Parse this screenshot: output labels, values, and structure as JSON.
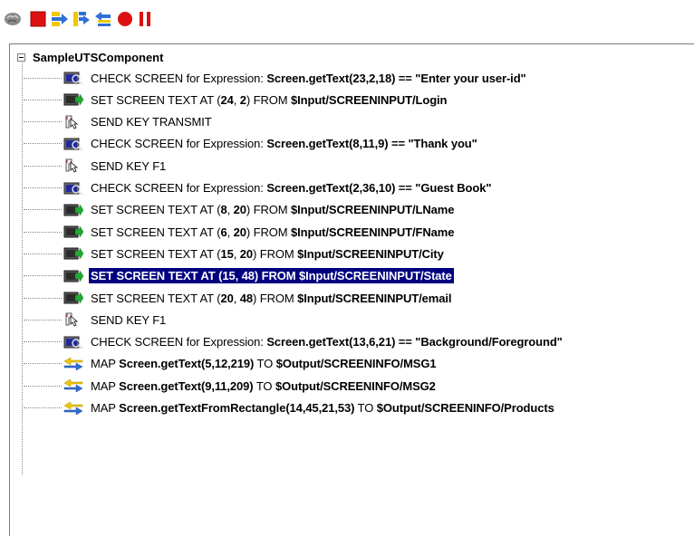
{
  "toolbar": {
    "buttons": [
      {
        "icon": "brain-icon"
      },
      {
        "icon": "stop-icon"
      },
      {
        "icon": "step-into-icon"
      },
      {
        "icon": "step-over-icon"
      },
      {
        "icon": "step-out-icon"
      },
      {
        "icon": "record-icon"
      },
      {
        "icon": "pause-icon"
      }
    ]
  },
  "tree": {
    "root_label": "SampleUTSComponent",
    "items": [
      {
        "kind": "check",
        "prefix": "CHECK SCREEN for Expression: ",
        "bold1": "Screen.getText(23,2,18) == \"Enter your user-id\"",
        "mid": "",
        "bold2": ""
      },
      {
        "kind": "set",
        "prefix": "SET SCREEN TEXT AT (",
        "bold1": "24",
        "mid": ", ",
        "bold2": "2",
        "mid2": ") FROM ",
        "bold3": "$Input/SCREENINPUT/Login"
      },
      {
        "kind": "key",
        "prefix": "SEND KEY TRANSMIT"
      },
      {
        "kind": "check",
        "prefix": "CHECK SCREEN for Expression: ",
        "bold1": "Screen.getText(8,11,9) == \"Thank you\""
      },
      {
        "kind": "key",
        "prefix": "SEND KEY F1"
      },
      {
        "kind": "check",
        "prefix": "CHECK SCREEN for Expression: ",
        "bold1": "Screen.getText(2,36,10) == \"Guest Book\""
      },
      {
        "kind": "set",
        "prefix": "SET SCREEN TEXT AT (",
        "bold1": "8",
        "mid": ", ",
        "bold2": "20",
        "mid2": ") FROM ",
        "bold3": "$Input/SCREENINPUT/LName"
      },
      {
        "kind": "set",
        "prefix": "SET SCREEN TEXT AT (",
        "bold1": "6",
        "mid": ", ",
        "bold2": "20",
        "mid2": ") FROM ",
        "bold3": "$Input/SCREENINPUT/FName"
      },
      {
        "kind": "set",
        "prefix": "SET SCREEN TEXT AT (",
        "bold1": "15",
        "mid": ", ",
        "bold2": "20",
        "mid2": ") FROM ",
        "bold3": "$Input/SCREENINPUT/City"
      },
      {
        "kind": "set-selected",
        "text": "SET SCREEN TEXT AT (15, 48) FROM $Input/SCREENINPUT/State"
      },
      {
        "kind": "set",
        "prefix": "SET SCREEN TEXT AT (",
        "bold1": "20",
        "mid": ", ",
        "bold2": "48",
        "mid2": ") FROM ",
        "bold3": "$Input/SCREENINPUT/email"
      },
      {
        "kind": "key",
        "prefix": "SEND KEY F1"
      },
      {
        "kind": "check",
        "prefix": "CHECK SCREEN for Expression: ",
        "bold1": "Screen.getText(13,6,21) == \"Background/Foreground\""
      },
      {
        "kind": "map",
        "prefix": "MAP ",
        "bold1": "Screen.getText(5,12,219)",
        "mid": " TO ",
        "bold2": "$Output/SCREENINFO/MSG1"
      },
      {
        "kind": "map",
        "prefix": "MAP ",
        "bold1": "Screen.getText(9,11,209)",
        "mid": " TO ",
        "bold2": "$Output/SCREENINFO/MSG2"
      },
      {
        "kind": "map",
        "prefix": "MAP ",
        "bold1": "Screen.getTextFromRectangle(14,45,21,53)",
        "mid": " TO ",
        "bold2": "$Output/SCREENINFO/Products"
      }
    ]
  },
  "colors": {
    "selection_bg": "#000080",
    "stop_red": "#dd1111",
    "arrow_blue": "#2f6fd6",
    "arrow_yellow": "#f0c800"
  }
}
